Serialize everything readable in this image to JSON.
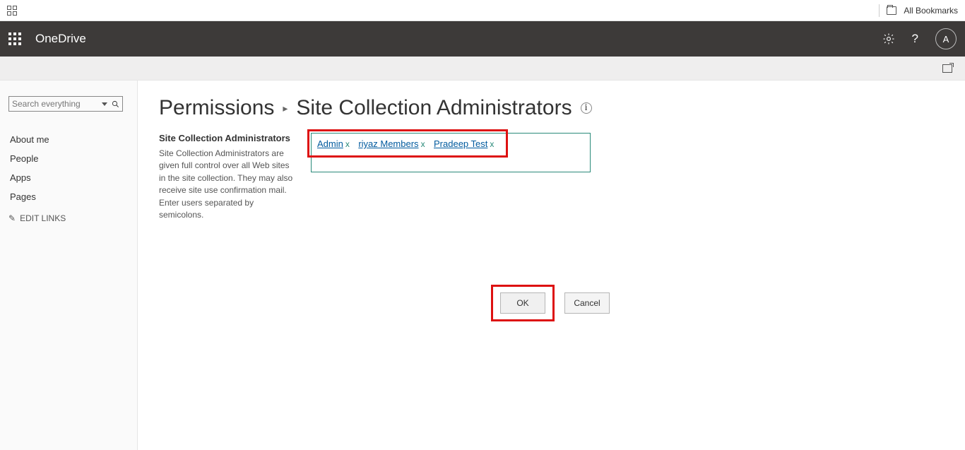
{
  "chrome": {
    "all_bookmarks": "All Bookmarks"
  },
  "suite": {
    "app_name": "OneDrive",
    "avatar_initial": "A"
  },
  "nav": {
    "search_placeholder": "Search everything",
    "items": [
      "About me",
      "People",
      "Apps",
      "Pages"
    ],
    "edit_links": "EDIT LINKS"
  },
  "page": {
    "breadcrumb_root": "Permissions",
    "title": "Site Collection Administrators"
  },
  "form": {
    "label": "Site Collection Administrators",
    "description": "Site Collection Administrators are given full control over all Web sites in the site collection. They may also receive site use confirmation mail. Enter users separated by semicolons.",
    "people": [
      {
        "name": "Admin"
      },
      {
        "name": "riyaz Members"
      },
      {
        "name": "Pradeep Test"
      }
    ]
  },
  "buttons": {
    "ok": "OK",
    "cancel": "Cancel"
  }
}
